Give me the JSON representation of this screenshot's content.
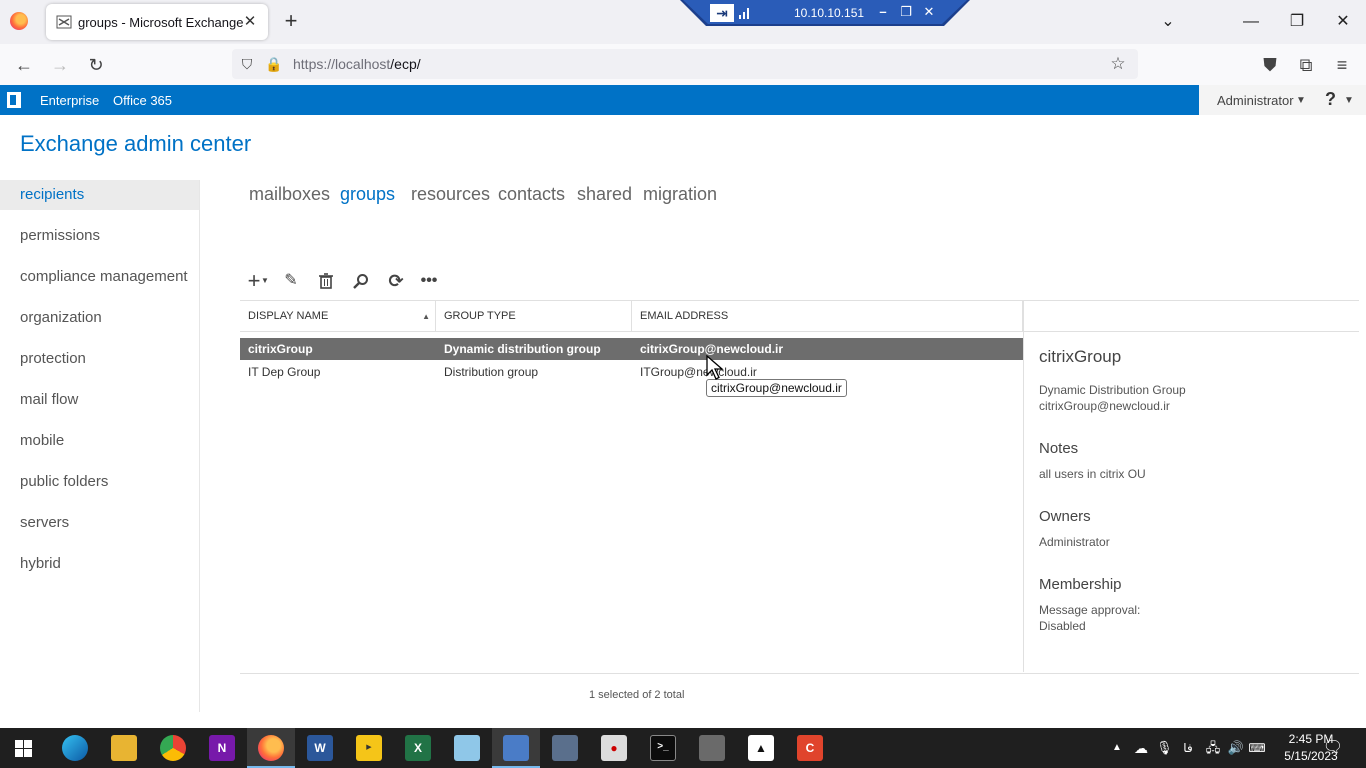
{
  "browser": {
    "tab_title": "groups - Microsoft Exchange",
    "url_host": "https://localhost",
    "url_path": "/ecp/",
    "rdp_host": "10.10.10.151"
  },
  "o365bar": {
    "links": [
      "Enterprise",
      "Office 365"
    ],
    "user": "Administrator",
    "help": "?"
  },
  "app_title": "Exchange admin center",
  "leftnav": [
    "recipients",
    "permissions",
    "compliance management",
    "organization",
    "protection",
    "mail flow",
    "mobile",
    "public folders",
    "servers",
    "hybrid"
  ],
  "leftnav_active": "recipients",
  "subtabs": [
    "mailboxes",
    "groups",
    "resources",
    "contacts",
    "shared",
    "migration"
  ],
  "subtab_active": "groups",
  "grid": {
    "columns": [
      "DISPLAY NAME",
      "GROUP TYPE",
      "EMAIL ADDRESS"
    ],
    "rows": [
      {
        "display_name": "citrixGroup",
        "group_type": "Dynamic distribution group",
        "email": "citrixGroup@newcloud.ir",
        "selected": true
      },
      {
        "display_name": "IT Dep Group",
        "group_type": "Distribution group",
        "email": "ITGroup@newcloud.ir",
        "selected": false
      }
    ],
    "status": "1 selected of 2 total",
    "tooltip": "citrixGroup@newcloud.ir"
  },
  "details": {
    "name": "citrixGroup",
    "type": "Dynamic Distribution Group",
    "email": "citrixGroup@newcloud.ir",
    "notes_heading": "Notes",
    "notes": "all users in citrix OU",
    "owners_heading": "Owners",
    "owners": "Administrator",
    "membership_heading": "Membership",
    "membership_line1": "Message approval:",
    "membership_line2": "Disabled"
  },
  "taskbar": {
    "time": "2:45 PM",
    "date": "5/15/2023",
    "ime": "فا"
  },
  "colors": {
    "accent": "#0072c6",
    "selected_row": "#6d6d6d",
    "taskbar": "#1f1f1f"
  }
}
